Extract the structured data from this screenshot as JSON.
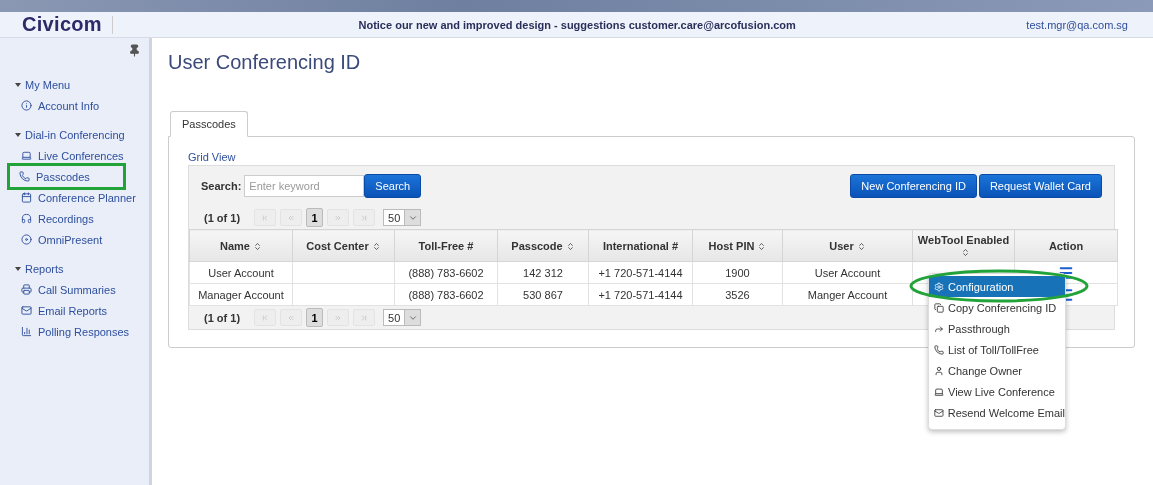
{
  "header": {
    "logo": "Civicom",
    "notice": "Notice our new and improved design - suggestions customer.care@arcofusion.com",
    "user": "test.mgr@qa.com.sg"
  },
  "sidebar": {
    "sections": [
      {
        "title": "My Menu",
        "expanded": true,
        "items": [
          {
            "label": "Account Info",
            "highlighted": false
          }
        ]
      },
      {
        "title": "Dial-in Conferencing",
        "expanded": true,
        "items": [
          {
            "label": "Live Conferences",
            "highlighted": false
          },
          {
            "label": "Passcodes",
            "highlighted": true
          },
          {
            "label": "Conference Planner",
            "highlighted": false
          },
          {
            "label": "Recordings",
            "highlighted": false
          },
          {
            "label": "OmniPresent",
            "highlighted": false
          }
        ]
      },
      {
        "title": "Reports",
        "expanded": true,
        "items": [
          {
            "label": "Call Summaries",
            "highlighted": false
          },
          {
            "label": "Email Reports",
            "highlighted": false
          },
          {
            "label": "Polling Responses",
            "highlighted": false
          }
        ]
      }
    ]
  },
  "page": {
    "title": "User Conferencing ID"
  },
  "tabs": [
    {
      "label": "Passcodes",
      "selected": true
    }
  ],
  "grid": {
    "view_link": "Grid View",
    "search": {
      "label": "Search:",
      "placeholder": "Enter keyword",
      "button": "Search"
    },
    "buttons": [
      "New Conferencing ID",
      "Request Wallet Card"
    ],
    "paginators": [
      {
        "status": "(1 of 1)",
        "pages": [
          {
            "label": "1",
            "selected": true
          }
        ],
        "rows_per_page": "50"
      },
      {
        "status": "(1 of 1)",
        "pages": [
          {
            "label": "1",
            "selected": true
          }
        ],
        "rows_per_page": "50"
      }
    ],
    "columns": [
      {
        "label": "Name",
        "sortable": true
      },
      {
        "label": "Cost Center",
        "sortable": true
      },
      {
        "label": "Toll-Free #",
        "sortable": false
      },
      {
        "label": "Passcode",
        "sortable": true
      },
      {
        "label": "International #",
        "sortable": false
      },
      {
        "label": "Host PIN",
        "sortable": true
      },
      {
        "label": "User",
        "sortable": true
      },
      {
        "label": "WebTool Enabled",
        "sortable": true
      },
      {
        "label": "Action",
        "sortable": false
      }
    ],
    "rows": [
      {
        "cells": [
          "User Account",
          null,
          "(888) 783-6602",
          "142 312",
          "+1 720-571-4144",
          "1900",
          "User Account",
          null
        ],
        "action_menu": true
      },
      {
        "cells": [
          "Manager Account",
          null,
          "(888) 783-6602",
          "530 867",
          "+1 720-571-4144",
          "3526",
          "Manger Account",
          null
        ],
        "action_menu": true
      }
    ]
  },
  "action_menu": {
    "items": [
      {
        "label": "Configuration",
        "selected": true,
        "highlighted": true
      },
      {
        "label": "Copy Conferencing ID",
        "selected": false,
        "highlighted": false
      },
      {
        "label": "Passthrough",
        "selected": false,
        "highlighted": false
      },
      {
        "label": "List of Toll/TollFree",
        "selected": false,
        "highlighted": false
      },
      {
        "label": "Change Owner",
        "selected": false,
        "highlighted": false
      },
      {
        "label": "View Live Conference",
        "selected": false,
        "highlighted": false
      },
      {
        "label": "Resend Welcome Email",
        "selected": false,
        "highlighted": false
      }
    ]
  }
}
